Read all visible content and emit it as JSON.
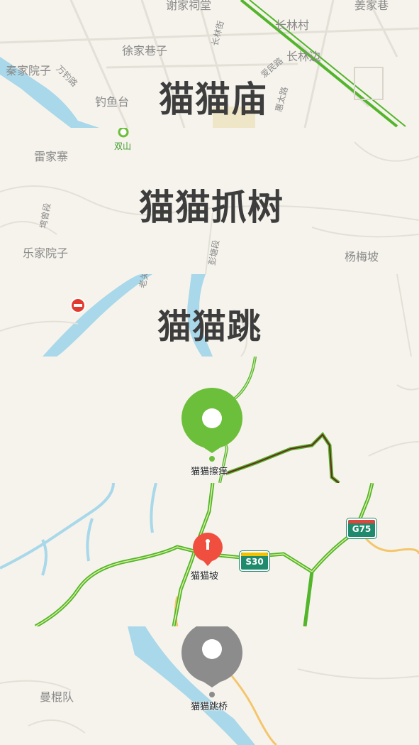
{
  "tiles": {
    "t1": {
      "title": "猫猫庙",
      "labels": [
        "谢家祠堂",
        "长林村",
        "姜家巷",
        "徐家巷子",
        "长林街",
        "长林边",
        "秦家院子",
        "万钓路",
        "爱民路",
        "钓鱼台",
        "惠太路"
      ]
    },
    "t2": {
      "title": "猫猫抓树",
      "labels": [
        "双山",
        "雷家寨",
        "塆曾段",
        "乐家院子",
        "彭塘段",
        "杨梅坡"
      ]
    },
    "t3": {
      "title": "猫猫跳",
      "labels": [
        "老关"
      ]
    },
    "t4": {
      "pin_label": "猫猫擦痒"
    },
    "t5": {
      "pin_label": "猫猫坡",
      "shields": [
        "S30",
        "G75"
      ]
    },
    "t6": {
      "pin_label": "猫猫跳桥",
      "labels": [
        "曼棍队"
      ]
    }
  },
  "colors": {
    "green_pin": "#6cbf3a",
    "red_pin": "#f04e3e",
    "gray_pin": "#8c8c8c",
    "water": "#a8d8ea",
    "road_green": "#52b52b",
    "shield_green": "#1f8a6c"
  },
  "icons": [
    "location-pin-icon",
    "no-entry-icon",
    "highway-shield-icon"
  ]
}
